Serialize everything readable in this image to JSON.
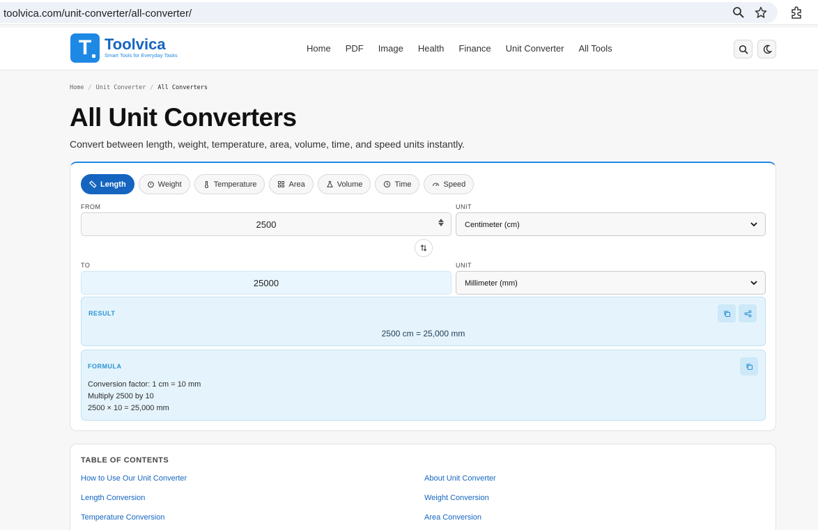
{
  "browser": {
    "url": "toolvica.com/unit-converter/all-converter/"
  },
  "header": {
    "logo_name": "Toolvica",
    "logo_tagline": "Smart Tools for Everyday Tasks",
    "logo_letter": "T",
    "nav": [
      "Home",
      "PDF",
      "Image",
      "Health",
      "Finance",
      "Unit Converter",
      "All Tools"
    ]
  },
  "breadcrumb": {
    "items": [
      "Home",
      "Unit Converter",
      "All Converters"
    ],
    "separator": "/"
  },
  "page": {
    "title": "All Unit Converters",
    "subtitle": "Convert between length, weight, temperature, area, volume, time, and speed units instantly."
  },
  "converter": {
    "tabs": [
      "Length",
      "Weight",
      "Temperature",
      "Area",
      "Volume",
      "Time",
      "Speed"
    ],
    "active_tab": "Length",
    "from_label": "FROM",
    "unit_label": "UNIT",
    "to_label": "TO",
    "from_value": "2500",
    "from_unit": "Centimeter (cm)",
    "to_value": "25000",
    "to_unit": "Millimeter (mm)",
    "result_label": "RESULT",
    "result_text": "2500 cm = 25,000 mm",
    "formula_label": "FORMULA",
    "formula_lines": [
      "Conversion factor: 1 cm = 10 mm",
      "Multiply 2500 by 10",
      "2500 × 10 = 25,000 mm"
    ]
  },
  "toc": {
    "title": "TABLE OF CONTENTS",
    "links": [
      "How to Use Our Unit Converter",
      "About Unit Converter",
      "Length Conversion",
      "Weight Conversion",
      "Temperature Conversion",
      "Area Conversion"
    ]
  },
  "colors": {
    "accent": "#1565c0",
    "brand": "#1e88e5",
    "result_bg": "#e5f4fc"
  }
}
